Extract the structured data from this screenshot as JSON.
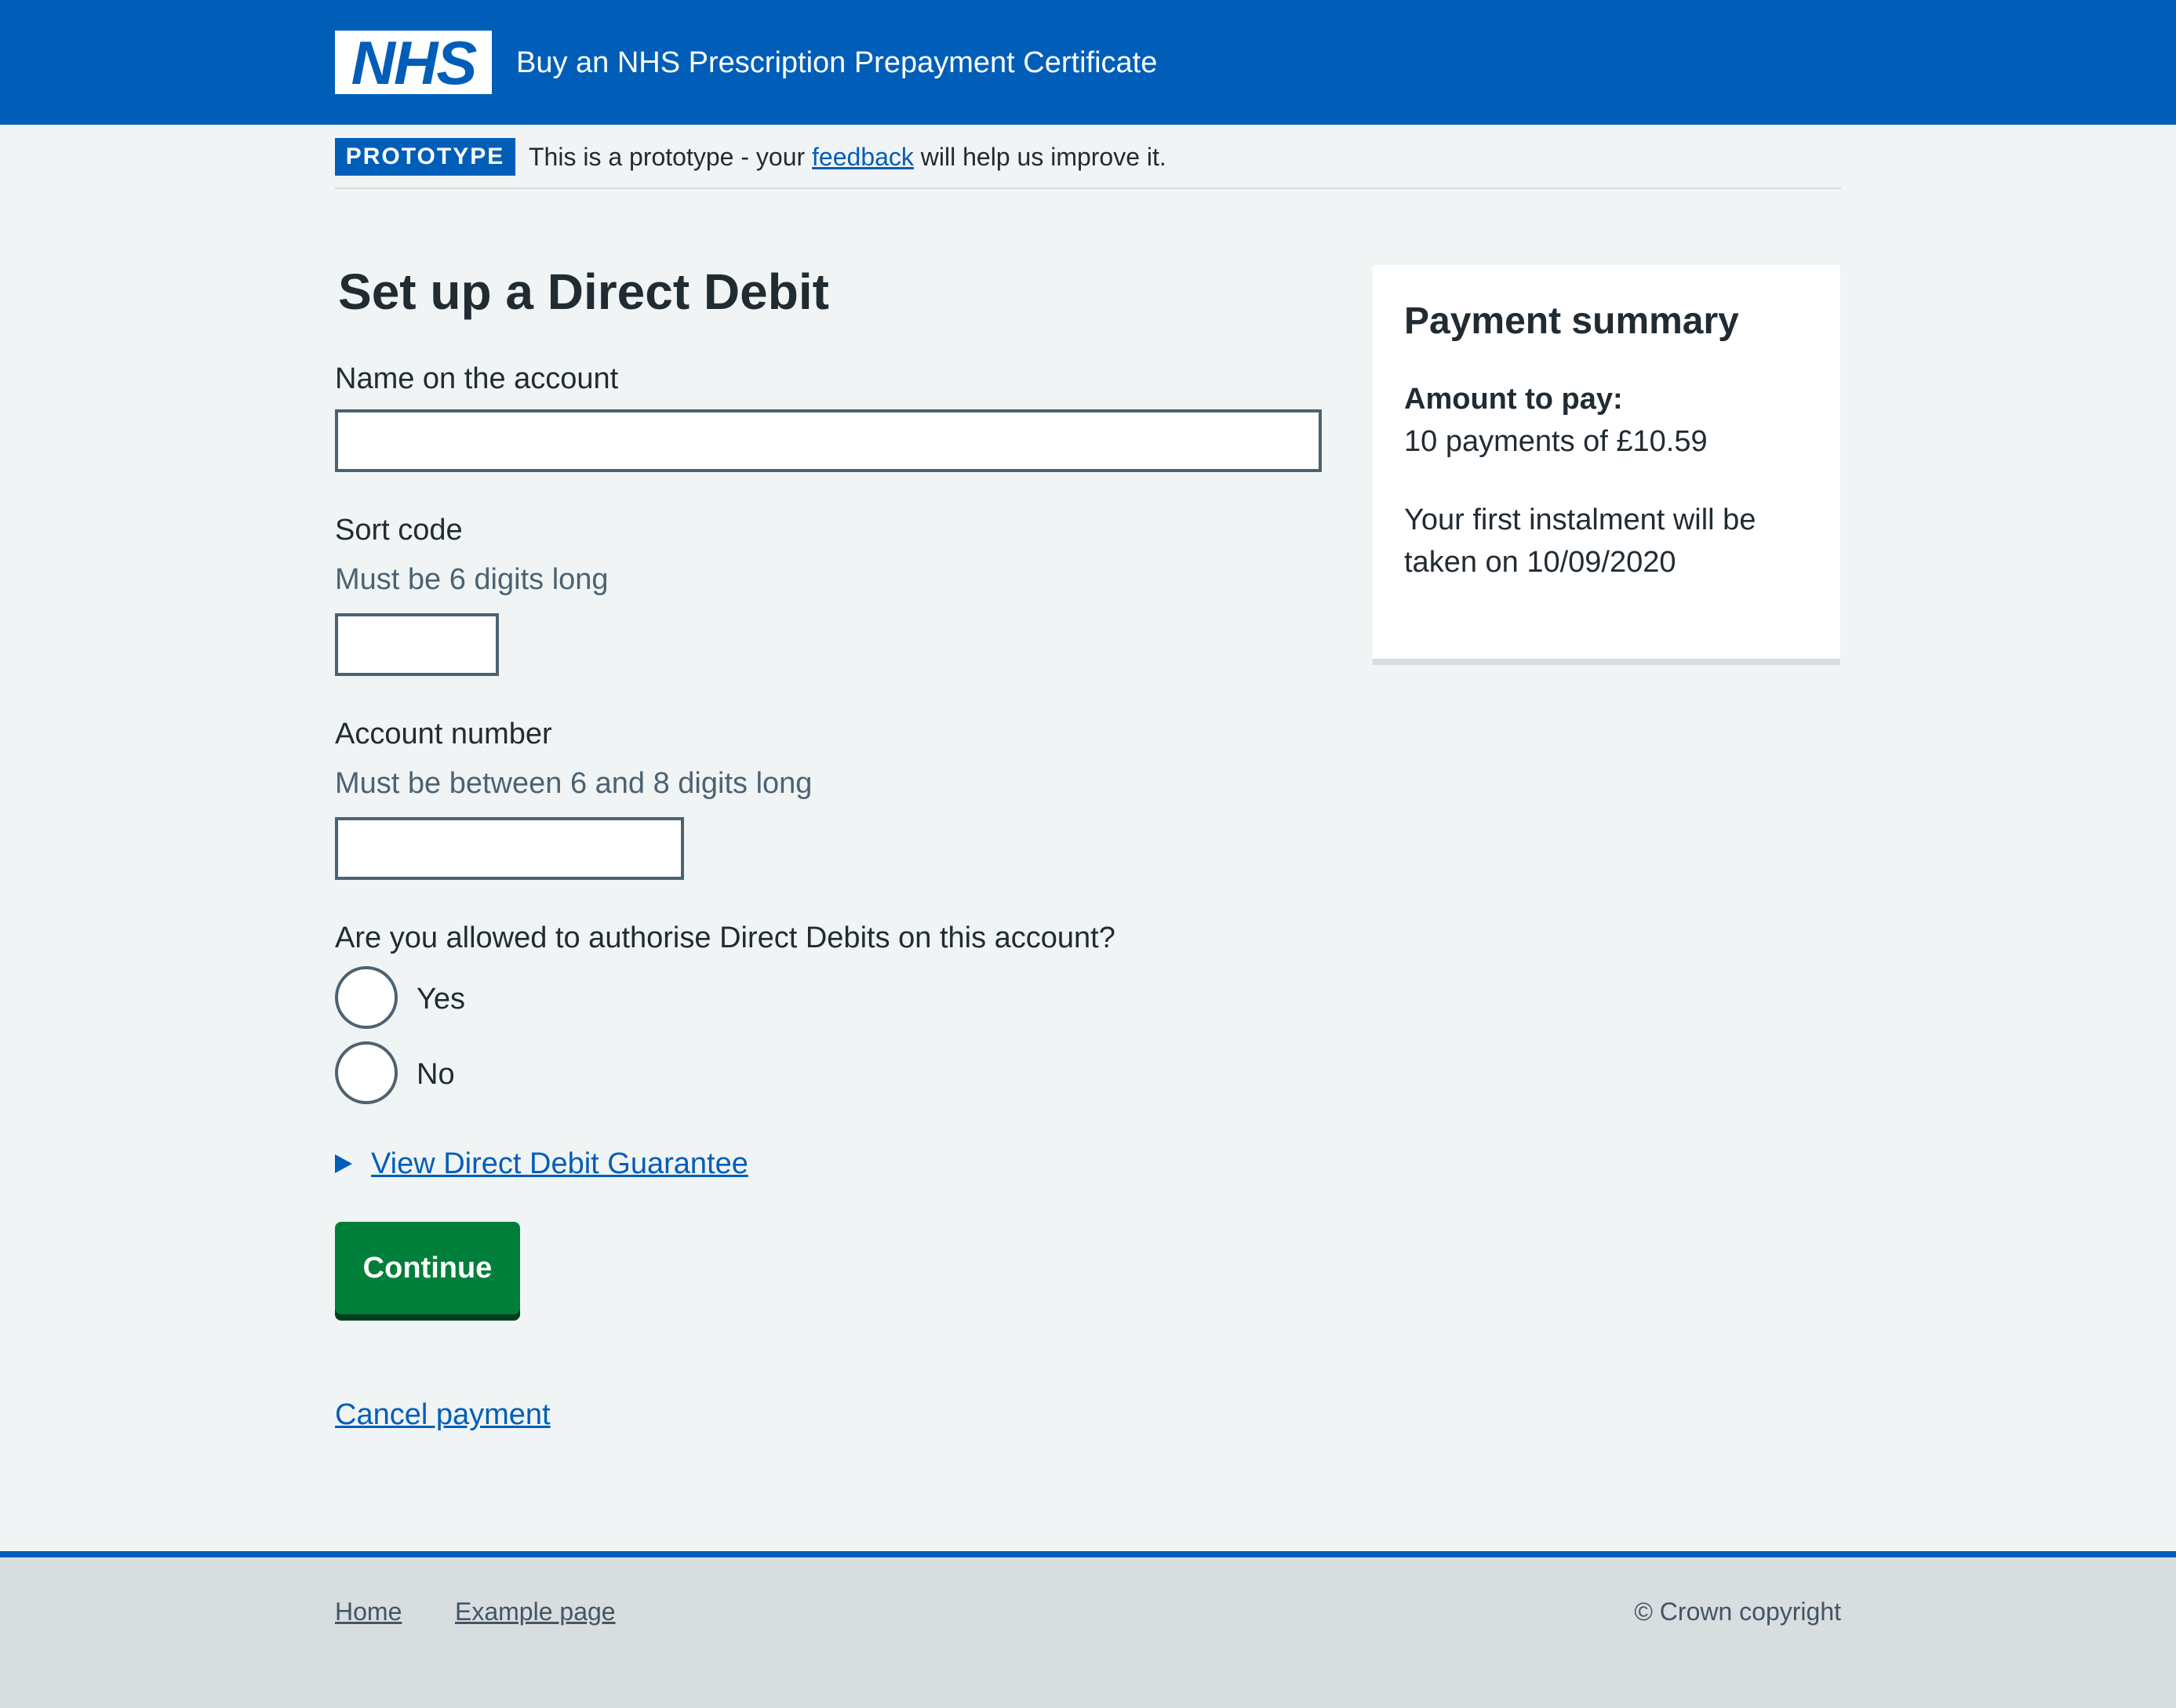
{
  "header": {
    "logo_text": "NHS",
    "service_name": "Buy an NHS Prescription Prepayment Certificate"
  },
  "phase_banner": {
    "tag": "PROTOTYPE",
    "text_before": "This is a prototype - your ",
    "link": "feedback",
    "text_after": " will help us improve it."
  },
  "form": {
    "title": "Set up a Direct Debit",
    "name": {
      "label": "Name on the account",
      "value": ""
    },
    "sort_code": {
      "label": "Sort code",
      "hint": "Must be 6 digits long",
      "value": ""
    },
    "account_number": {
      "label": "Account number",
      "hint": "Must be between 6 and 8 digits long",
      "value": ""
    },
    "authorise": {
      "question": "Are you allowed to authorise Direct Debits on this account?",
      "options": [
        "Yes",
        "No"
      ]
    },
    "guarantee_link": "View Direct Debit Guarantee",
    "continue_button": "Continue",
    "cancel_link": "Cancel payment"
  },
  "summary": {
    "title": "Payment summary",
    "amount_label": "Amount to pay:",
    "amount_value": "10 payments of £10.59",
    "instalment_note": "Your first instalment will be taken on 10/09/2020"
  },
  "footer": {
    "links": [
      "Home",
      "Example page"
    ],
    "copyright": "© Crown copyright"
  },
  "colors": {
    "nhs_blue": "#005eb8",
    "button_green": "#007f3b",
    "page_background": "#f0f4f5",
    "footer_background": "#d8dde0"
  }
}
